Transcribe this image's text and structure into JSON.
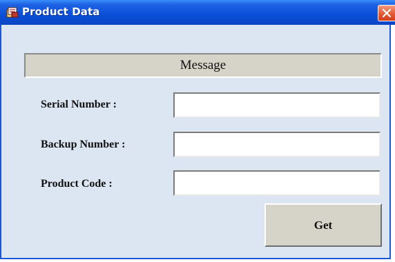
{
  "window": {
    "title": "Product Data",
    "icon": "product-data-app-icon",
    "close_icon": "close-icon",
    "titlebar_color": "#0a4fd8",
    "background_color": "#dce6f2"
  },
  "message": {
    "text": "Message"
  },
  "fields": {
    "serial_number": {
      "label": "Serial Number :",
      "value": "",
      "placeholder": ""
    },
    "backup_number": {
      "label": "Backup Number :",
      "value": "",
      "placeholder": ""
    },
    "product_code": {
      "label": "Product Code :",
      "value": "",
      "placeholder": ""
    }
  },
  "actions": {
    "get_label": "Get"
  }
}
